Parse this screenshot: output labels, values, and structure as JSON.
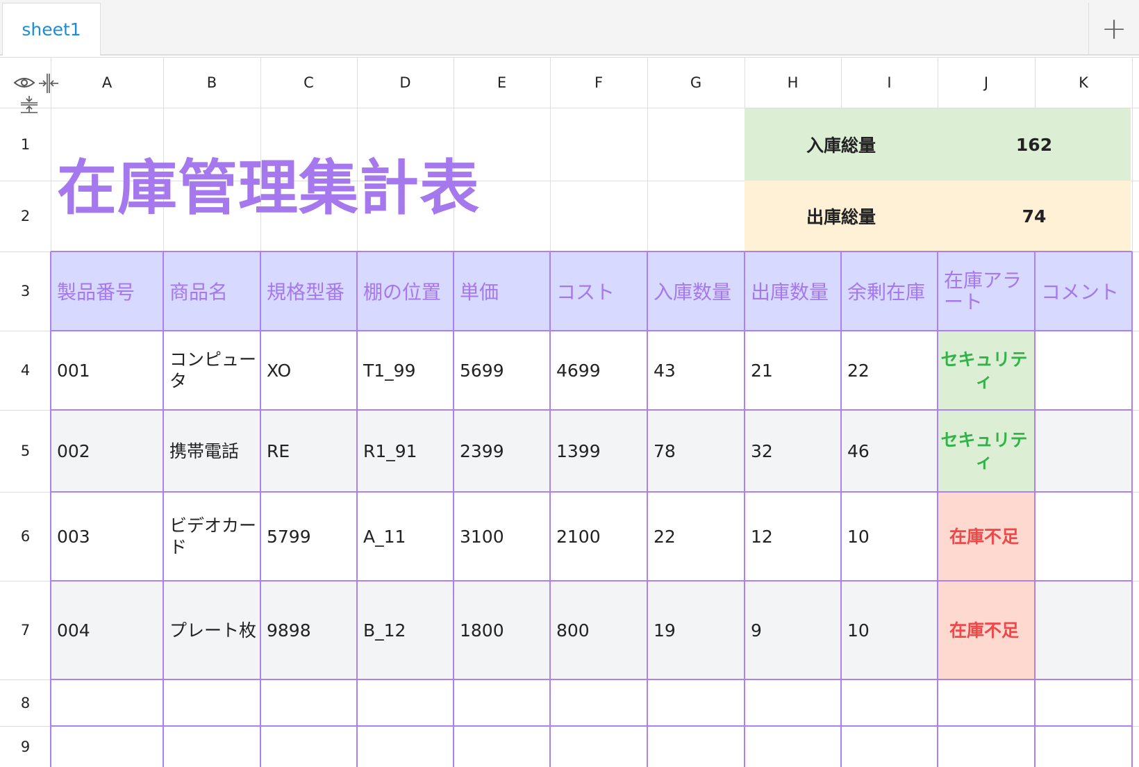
{
  "tab_bar": {
    "sheet_tab_label": "sheet1",
    "add_sheet_symbol": "+"
  },
  "column_headers": [
    "A",
    "B",
    "C",
    "D",
    "E",
    "F",
    "G",
    "H",
    "I",
    "J",
    "K"
  ],
  "row_headers": [
    "1",
    "2",
    "3",
    "4",
    "5",
    "6",
    "7",
    "8",
    "9"
  ],
  "sheet": {
    "title": "在庫管理集計表",
    "summary": {
      "inbound_label": "入庫総量",
      "inbound_value": "162",
      "outbound_label": "出庫総量",
      "outbound_value": "74"
    },
    "table_headers": [
      "製品番号",
      "商品名",
      "規格型番",
      "棚の位置",
      "単価",
      "コスト",
      "入庫数量",
      "出庫数量",
      "余剰在庫",
      "在庫アラート",
      "コメント"
    ],
    "rows": [
      [
        "001",
        "コンピュータ",
        "XO",
        "T1_99",
        "5699",
        "4699",
        "43",
        "21",
        "22",
        "セキュリティ",
        ""
      ],
      [
        "002",
        "携帯電話",
        "RE",
        "R1_91",
        "2399",
        "1399",
        "78",
        "32",
        "46",
        "セキュリティ",
        ""
      ],
      [
        "003",
        "ビデオカード",
        "5799",
        "A_11",
        "3100",
        "2100",
        "22",
        "12",
        "10",
        "在庫不足",
        ""
      ],
      [
        "004",
        "プレート枚",
        "9898",
        "B_12",
        "1800",
        "800",
        "19",
        "9",
        "10",
        "在庫不足",
        ""
      ]
    ]
  },
  "colors": {
    "header_fill": "#d8d9ff",
    "header_text": "#a678ee",
    "border": "#ad80f2",
    "alert_ok_fill": "#dcefd5",
    "alert_ok_text": "#33b24a",
    "alert_ng_fill": "#fdd9d0",
    "alert_ng_text": "#f04848",
    "inbound_fill": "#dcefd5",
    "outbound_fill": "#fff1d6",
    "tab_text": "#1a8cd8"
  },
  "icons": [
    "eye-icon",
    "collapse-columns-icon",
    "collapse-rows-icon",
    "plus-icon"
  ]
}
